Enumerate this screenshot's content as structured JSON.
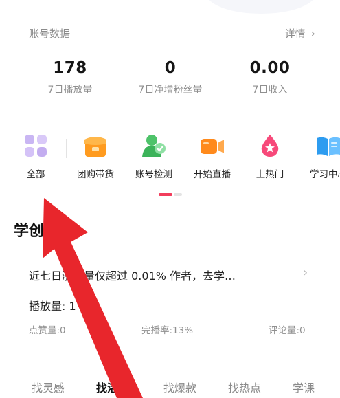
{
  "account": {
    "title": "账号数据",
    "detail_label": "详情",
    "stats": [
      {
        "value": "178",
        "label": "7日播放量"
      },
      {
        "value": "0",
        "label": "7日净增粉丝量"
      },
      {
        "value": "0.00",
        "label": "7日收入"
      }
    ]
  },
  "tools": [
    {
      "label": "全部",
      "icon": "grid-icon"
    },
    {
      "label": "团购带货",
      "icon": "store-icon"
    },
    {
      "label": "账号检测",
      "icon": "account-check-icon"
    },
    {
      "label": "开始直播",
      "icon": "video-camera-icon"
    },
    {
      "label": "上热门",
      "icon": "fire-drop-icon"
    },
    {
      "label": "学习中心",
      "icon": "book-icon"
    }
  ],
  "section": {
    "title": "学创",
    "card_text": "近七日涨粉量仅超过 0.01% 作者，去学…",
    "plays_label": "播放量: 1",
    "metrics": {
      "likes": "点赞量:0",
      "completion": "完播率:13%",
      "comments": "评论量:0"
    }
  },
  "bottom_tabs": [
    {
      "label": "找灵感",
      "active": false
    },
    {
      "label": "找活动",
      "active": true
    },
    {
      "label": "找爆款",
      "active": false
    },
    {
      "label": "找热点",
      "active": false
    },
    {
      "label": "学课",
      "active": false
    }
  ],
  "colors": {
    "accent": "#f23d5c",
    "annotation_arrow": "#e8262c",
    "muted_text": "#8f8f8f"
  }
}
